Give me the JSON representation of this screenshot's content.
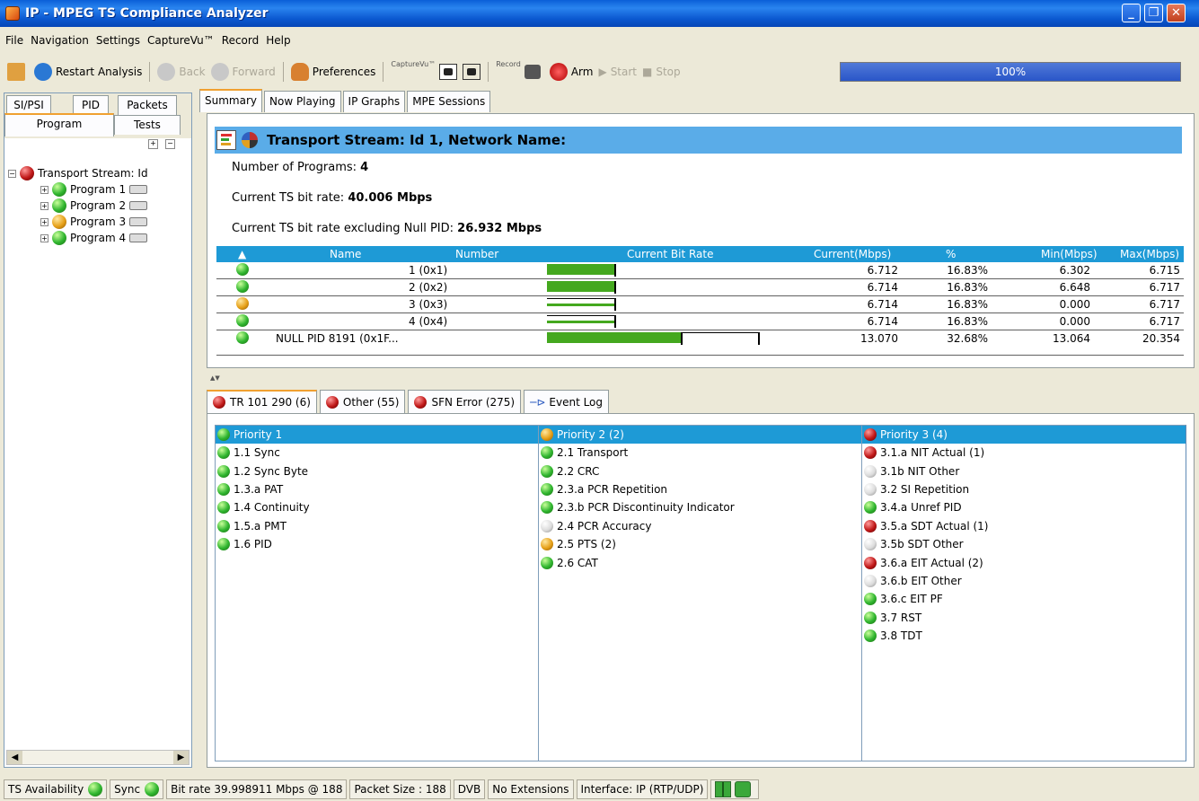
{
  "window": {
    "title": "IP - MPEG TS Compliance Analyzer"
  },
  "menu": [
    "File",
    "Navigation",
    "Settings",
    "CaptureVu™",
    "Record",
    "Help"
  ],
  "toolbar": {
    "restart": "Restart Analysis",
    "back": "Back",
    "forward": "Forward",
    "preferences": "Preferences",
    "capture_label": "CaptureVu™",
    "record_label": "Record",
    "arm": "Arm",
    "start": "Start",
    "stop": "Stop",
    "progress": "100%"
  },
  "left_tabs": {
    "sipsi": "SI/PSI",
    "pid": "PID",
    "packets": "Packets",
    "program": "Program",
    "tests": "Tests"
  },
  "tree": {
    "root": "Transport Stream: Id",
    "programs": [
      {
        "label": "Program 1",
        "status": "green"
      },
      {
        "label": "Program 2",
        "status": "green"
      },
      {
        "label": "Program 3",
        "status": "orange"
      },
      {
        "label": "Program 4",
        "status": "green"
      }
    ]
  },
  "main_tabs": [
    "Summary",
    "Now Playing",
    "IP Graphs",
    "MPE Sessions"
  ],
  "summary": {
    "header": "Transport Stream: Id 1, Network Name:",
    "num_programs_label": "Number of Programs:",
    "num_programs": "4",
    "bitrate_label": "Current TS bit rate:",
    "bitrate": "40.006 Mbps",
    "bitrate_null_label": "Current TS bit rate excluding Null PID:",
    "bitrate_null": "26.932 Mbps"
  },
  "table": {
    "columns": [
      "Name",
      "Number",
      "Current Bit Rate",
      "Current(Mbps)",
      "%",
      "Min(Mbps)",
      "Max(Mbps)"
    ],
    "rows": [
      {
        "status": "green",
        "name": "",
        "number": "1 (0x1)",
        "current": "6.712",
        "pct": "16.83%",
        "min": "6.302",
        "max": "6.715",
        "bar_fraction": 0.33
      },
      {
        "status": "green",
        "name": "",
        "number": "2 (0x2)",
        "current": "6.714",
        "pct": "16.83%",
        "min": "6.648",
        "max": "6.717",
        "bar_fraction": 0.33
      },
      {
        "status": "orange",
        "name": "",
        "number": "3 (0x3)",
        "current": "6.714",
        "pct": "16.83%",
        "min": "0.000",
        "max": "6.717",
        "bar_fraction": 0.33
      },
      {
        "status": "green",
        "name": "",
        "number": "4 (0x4)",
        "current": "6.714",
        "pct": "16.83%",
        "min": "0.000",
        "max": "6.717",
        "bar_fraction": 0.33
      },
      {
        "status": "green",
        "name": "NULL PID 8191 (0x1F...",
        "number": "",
        "current": "13.070",
        "pct": "32.68%",
        "min": "13.064",
        "max": "20.354",
        "bar_fraction": 0.65
      }
    ]
  },
  "bottom_tabs": [
    {
      "label": "TR 101 290 (6)",
      "status": "red"
    },
    {
      "label": "Other (55)",
      "status": "red"
    },
    {
      "label": "SFN Error (275)",
      "status": "red"
    },
    {
      "label": "Event Log",
      "status": "pin"
    }
  ],
  "priority1": {
    "header": "Priority 1",
    "status": "green",
    "items": [
      {
        "label": "1.1 Sync",
        "status": "green"
      },
      {
        "label": "1.2 Sync Byte",
        "status": "green"
      },
      {
        "label": "1.3.a PAT",
        "status": "green"
      },
      {
        "label": "1.4 Continuity",
        "status": "green"
      },
      {
        "label": "1.5.a PMT",
        "status": "green"
      },
      {
        "label": "1.6 PID",
        "status": "green"
      }
    ]
  },
  "priority2": {
    "header": "Priority 2 (2)",
    "status": "orange",
    "items": [
      {
        "label": "2.1 Transport",
        "status": "green"
      },
      {
        "label": "2.2 CRC",
        "status": "green"
      },
      {
        "label": "2.3.a PCR Repetition",
        "status": "green"
      },
      {
        "label": "2.3.b PCR Discontinuity Indicator",
        "status": "green"
      },
      {
        "label": "2.4 PCR Accuracy",
        "status": "white"
      },
      {
        "label": "2.5 PTS (2)",
        "status": "orange"
      },
      {
        "label": "2.6 CAT",
        "status": "green"
      }
    ]
  },
  "priority3": {
    "header": "Priority 3 (4)",
    "status": "red",
    "items": [
      {
        "label": "3.1.a NIT Actual (1)",
        "status": "red"
      },
      {
        "label": "3.1b NIT Other",
        "status": "white"
      },
      {
        "label": "3.2 SI Repetition",
        "status": "white"
      },
      {
        "label": "3.4.a Unref PID",
        "status": "green"
      },
      {
        "label": "3.5.a SDT Actual (1)",
        "status": "red"
      },
      {
        "label": "3.5b SDT Other",
        "status": "white"
      },
      {
        "label": "3.6.a EIT Actual (2)",
        "status": "red"
      },
      {
        "label": "3.6.b EIT Other",
        "status": "white"
      },
      {
        "label": "3.6.c EIT PF",
        "status": "green"
      },
      {
        "label": "3.7 RST",
        "status": "green"
      },
      {
        "label": "3.8 TDT",
        "status": "green"
      }
    ]
  },
  "status": {
    "ts_availability": "TS Availability",
    "sync": "Sync",
    "bitrate": "Bit rate  39.998911 Mbps @ 188",
    "packet_size": "Packet Size : 188",
    "dvb": "DVB",
    "extensions": "No Extensions",
    "interface": "Interface: IP (RTP/UDP)"
  },
  "colors": {
    "green": "#2fb52f",
    "red": "#c01818",
    "orange": "#e6a018",
    "white": "#dcdcdc",
    "table_header": "#1e9ad6",
    "bar": "#44a81e"
  }
}
